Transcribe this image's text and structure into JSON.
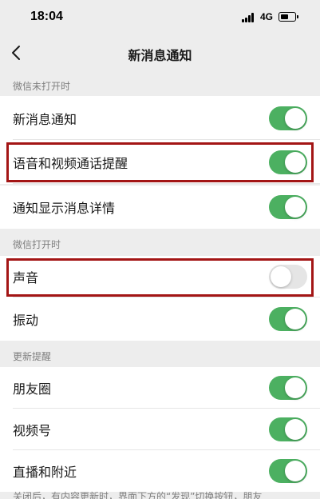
{
  "status_bar": {
    "time": "18:04",
    "network": "4G",
    "icons": [
      "signal-icon",
      "battery-icon"
    ]
  },
  "nav": {
    "title": "新消息通知",
    "back_icon": "chevron-left-icon"
  },
  "sections": [
    {
      "header": "微信未打开时",
      "rows": [
        {
          "label": "新消息通知",
          "toggle": "on"
        },
        {
          "label": "语音和视频通话提醒",
          "toggle": "on",
          "highlighted": true
        },
        {
          "label": "通知显示消息详情",
          "toggle": "on"
        }
      ]
    },
    {
      "header": "微信打开时",
      "rows": [
        {
          "label": "声音",
          "toggle": "off",
          "highlighted": true
        },
        {
          "label": "振动",
          "toggle": "on"
        }
      ]
    },
    {
      "header": "更新提醒",
      "rows": [
        {
          "label": "朋友圈",
          "toggle": "on"
        },
        {
          "label": "视频号",
          "toggle": "on"
        },
        {
          "label": "直播和附近",
          "toggle": "on"
        }
      ]
    }
  ],
  "footer_note": "关闭后，有内容更新时，界面下方的“发现”切换按钮，朋友",
  "colors": {
    "toggle_on": "#4cb061",
    "toggle_off": "#e5e5e5",
    "highlight": "#a31515",
    "background": "#ededed"
  }
}
